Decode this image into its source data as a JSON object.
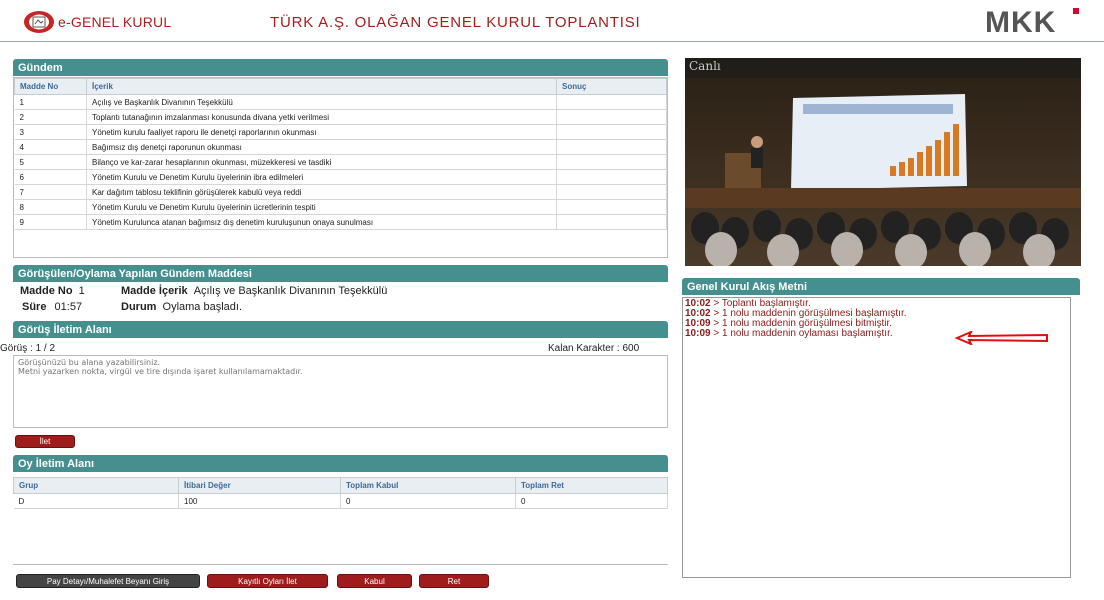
{
  "header": {
    "logo_text": "e-GENEL KURUL",
    "title": "TÜRK A.Ş. OLAĞAN GENEL KURUL TOPLANTISI",
    "brand": "MKK"
  },
  "agenda": {
    "title": "Gündem",
    "columns": [
      "Madde No",
      "İçerik",
      "Sonuç"
    ],
    "rows": [
      {
        "no": "1",
        "content": "Açılış ve Başkanlık Divanının Teşekkülü",
        "result": ""
      },
      {
        "no": "2",
        "content": "Toplantı tutanağının imzalanması konusunda divana yetki verilmesi",
        "result": ""
      },
      {
        "no": "3",
        "content": "Yönetim kurulu faaliyet raporu ile denetçi raporlarının okunması",
        "result": ""
      },
      {
        "no": "4",
        "content": "Bağımsız dış denetçi raporunun okunması",
        "result": ""
      },
      {
        "no": "5",
        "content": "Bilanço ve kar-zarar hesaplarının okunması, müzekkeresi ve tasdiki",
        "result": ""
      },
      {
        "no": "6",
        "content": "Yönetim Kurulu ve Denetim Kurulu üyelerinin ibra edilmeleri",
        "result": ""
      },
      {
        "no": "7",
        "content": "Kar dağıtım tablosu teklifinin görüşülerek kabulü veya reddi",
        "result": ""
      },
      {
        "no": "8",
        "content": "Yönetim Kurulu ve Denetim Kurulu üyelerinin ücretlerinin tespiti",
        "result": ""
      },
      {
        "no": "9",
        "content": "Yönetim Kurulunca atanan bağımsız dış denetim kuruluşunun onaya sunulması",
        "result": ""
      }
    ]
  },
  "current": {
    "title": "Görüşülen/Oylama Yapılan Gündem Maddesi",
    "madde_no_label": "Madde No",
    "madde_no": "1",
    "icerik_label": "Madde İçerik",
    "icerik": "Açılış ve Başkanlık Divanının Teşekkülü",
    "sure_label": "Süre",
    "sure": "01:57",
    "durum_label": "Durum",
    "durum": "Oylama başladı."
  },
  "opinion": {
    "title": "Görüş İletim Alanı",
    "count_label": "Görüş : 1 / 2",
    "remaining_label": "Kalan Karakter : 600",
    "placeholder": "Görüşünüzü bu alana yazabilirsiniz.\nMetni yazarken nokta, virgül ve tire dışında işaret kullanılamamaktadır.",
    "send_button": "İlet"
  },
  "vote": {
    "title": "Oy İletim Alanı",
    "columns": [
      "Grup",
      "İtibari Değer",
      "Toplam Kabul",
      "Toplam Ret"
    ],
    "rows": [
      {
        "group": "D",
        "nominal": "100",
        "accept": "0",
        "reject": "0"
      }
    ]
  },
  "buttons": {
    "pay_detay": "Pay Detayı/Muhalefet Beyanı Giriş",
    "kayitli": "Kayıtlı Oyları İlet",
    "kabul": "Kabul",
    "ret": "Ret"
  },
  "video": {
    "live_label": "Canlı"
  },
  "flow": {
    "title": "Genel Kurul Akış Metni",
    "lines": [
      {
        "time": "10:02",
        "text": " > Toplantı başlamıştır."
      },
      {
        "time": "10:02",
        "text": " > 1 nolu maddenin görüşülmesi başlamıştır."
      },
      {
        "time": "10:09",
        "text": " > 1 nolu maddenin görüşülmesi bitmiştir."
      },
      {
        "time": "10:09",
        "text": " > 1 nolu maddenin oylaması başlamıştır."
      }
    ]
  },
  "colors": {
    "accent": "#45908f",
    "brand_red": "#a51d1d",
    "button_red": "#9e1c1c"
  }
}
